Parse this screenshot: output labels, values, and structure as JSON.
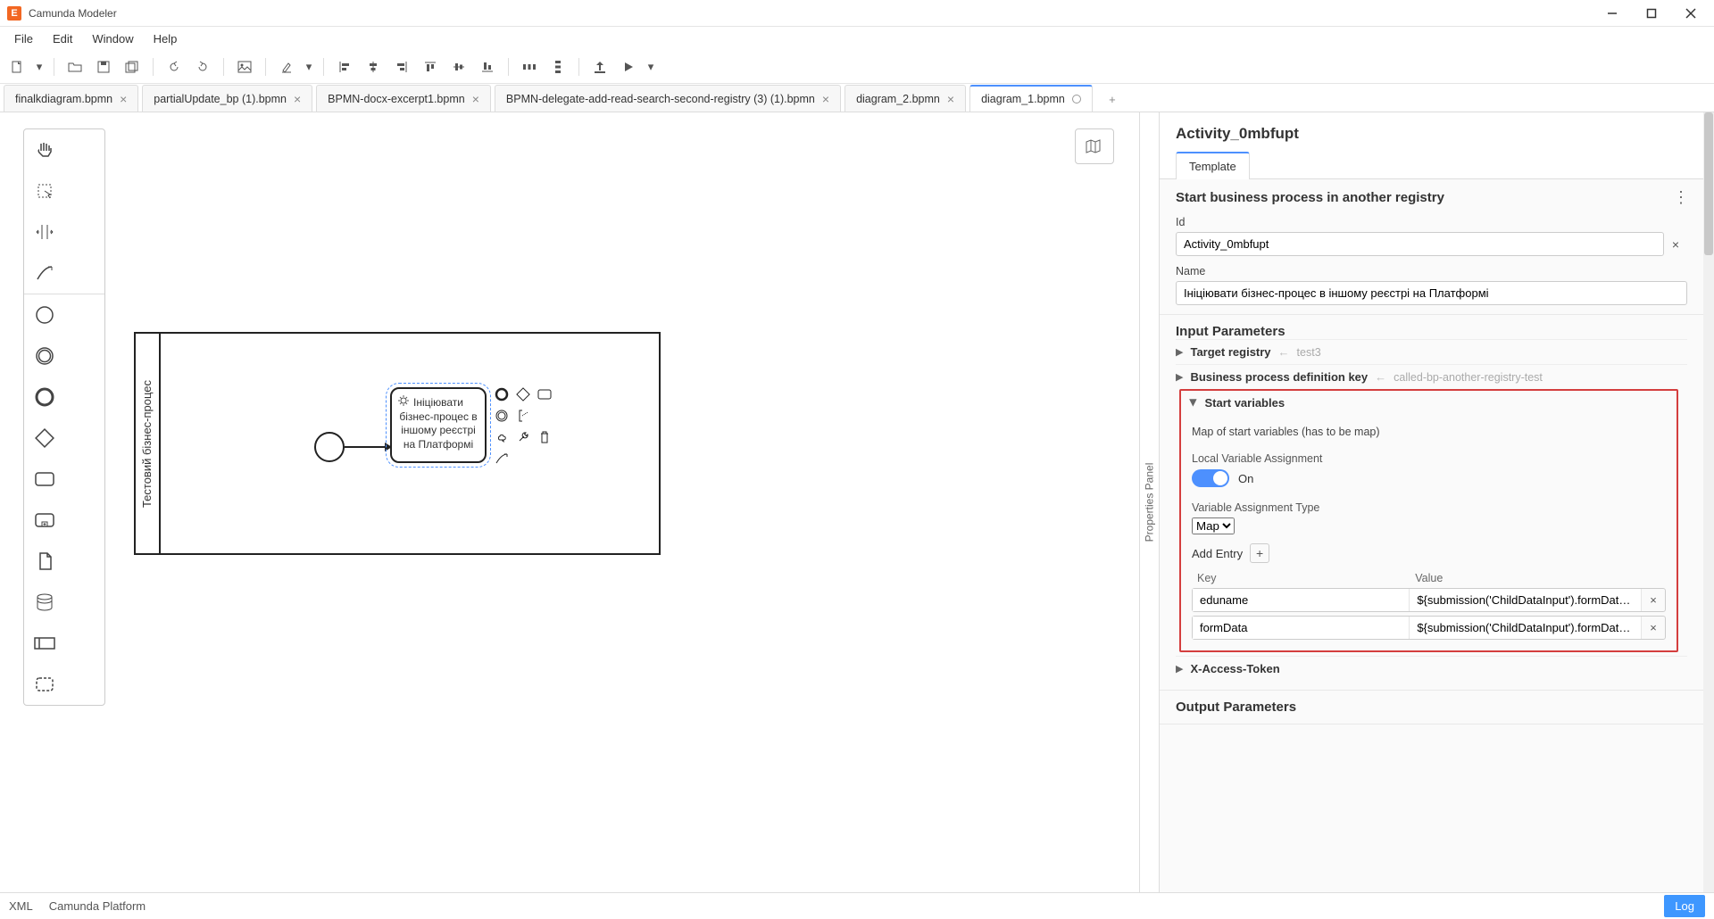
{
  "window": {
    "title": "Camunda Modeler"
  },
  "menu": {
    "file": "File",
    "edit": "Edit",
    "window": "Window",
    "help": "Help"
  },
  "tabs": [
    {
      "label": "finalkdiagram.bpmn"
    },
    {
      "label": "partialUpdate_bp (1).bpmn"
    },
    {
      "label": "BPMN-docx-excerpt1.bpmn"
    },
    {
      "label": "BPMN-delegate-add-read-search-second-registry (3) (1).bpmn"
    },
    {
      "label": "diagram_2.bpmn"
    },
    {
      "label": "diagram_1.bpmn"
    }
  ],
  "diagram": {
    "lane_title": "Тестовий бізнес-процес",
    "task_text": "Ініціювати бізнес-процес в іншому реєстрі на Платформі"
  },
  "props": {
    "title": "Activity_0mbfupt",
    "tab_template": "Template",
    "group_title": "Start business process in another registry",
    "id_label": "Id",
    "id_value": "Activity_0mbfupt",
    "name_label": "Name",
    "name_value": "Ініціювати бізнес-процес в іншому реєстрі на Платформі",
    "input_params_title": "Input Parameters",
    "output_params_title": "Output Parameters",
    "target_registry_label": "Target registry",
    "target_registry_value": "test3",
    "bpdk_label": "Business process definition key",
    "bpdk_value": "called-bp-another-registry-test",
    "start_vars_label": "Start variables",
    "start_vars_hint": "Map of start variables (has to be map)",
    "lva_label": "Local Variable Assignment",
    "lva_state": "On",
    "vat_label": "Variable Assignment Type",
    "vat_value": "Map",
    "add_entry_label": "Add Entry",
    "kv_key_header": "Key",
    "kv_value_header": "Value",
    "entries": [
      {
        "k": "eduname",
        "v": "${submission('ChildDataInput').formData.pr"
      },
      {
        "k": "formData",
        "v": "${submission('ChildDataInput').formData.to"
      }
    ],
    "xaccess_label": "X-Access-Token",
    "panel_label": "Properties Panel"
  },
  "status": {
    "xml": "XML",
    "platform": "Camunda Platform",
    "log": "Log"
  }
}
